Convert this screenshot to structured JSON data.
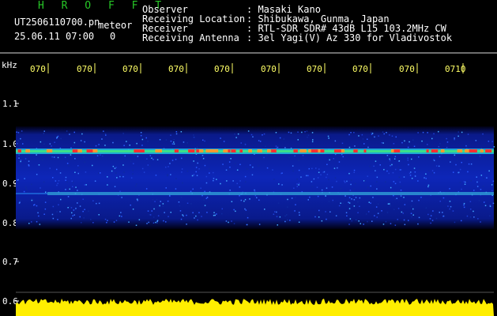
{
  "header": {
    "brand": "H R O F F T",
    "filename": "UT2506110700.pn",
    "filename_suffix": "meteor",
    "datetime": "25.06.11 07:00",
    "count": "0"
  },
  "meta": {
    "rows": [
      {
        "label": "Observer",
        "value": ": Masaki Kano"
      },
      {
        "label": "Receiving Location",
        "value": ": Shibukawa, Gunma, Japan"
      },
      {
        "label": "Receiver",
        "value": ": RTL-SDR SDR# 43dB L15 103.2MHz CW"
      },
      {
        "label": "Receiving Antenna",
        "value": ": 3el Yagi(V) Az 330 for Vladivostok"
      }
    ]
  },
  "axes": {
    "y_unit": "kHz",
    "y_ticks": [
      "1.1",
      "1.0",
      "0.9",
      "0.8",
      "0.7",
      "0.6"
    ],
    "time_ticks": [
      "070",
      "070",
      "070",
      "070",
      "070",
      "070",
      "070",
      "070",
      "070",
      "0710"
    ]
  },
  "colors": {
    "brand": "#27c727",
    "text": "#ffffff",
    "tick_label": "#ffff66",
    "signal_band": "#1a3cff",
    "hot": "#ff3030",
    "power": "#ffee00"
  }
}
